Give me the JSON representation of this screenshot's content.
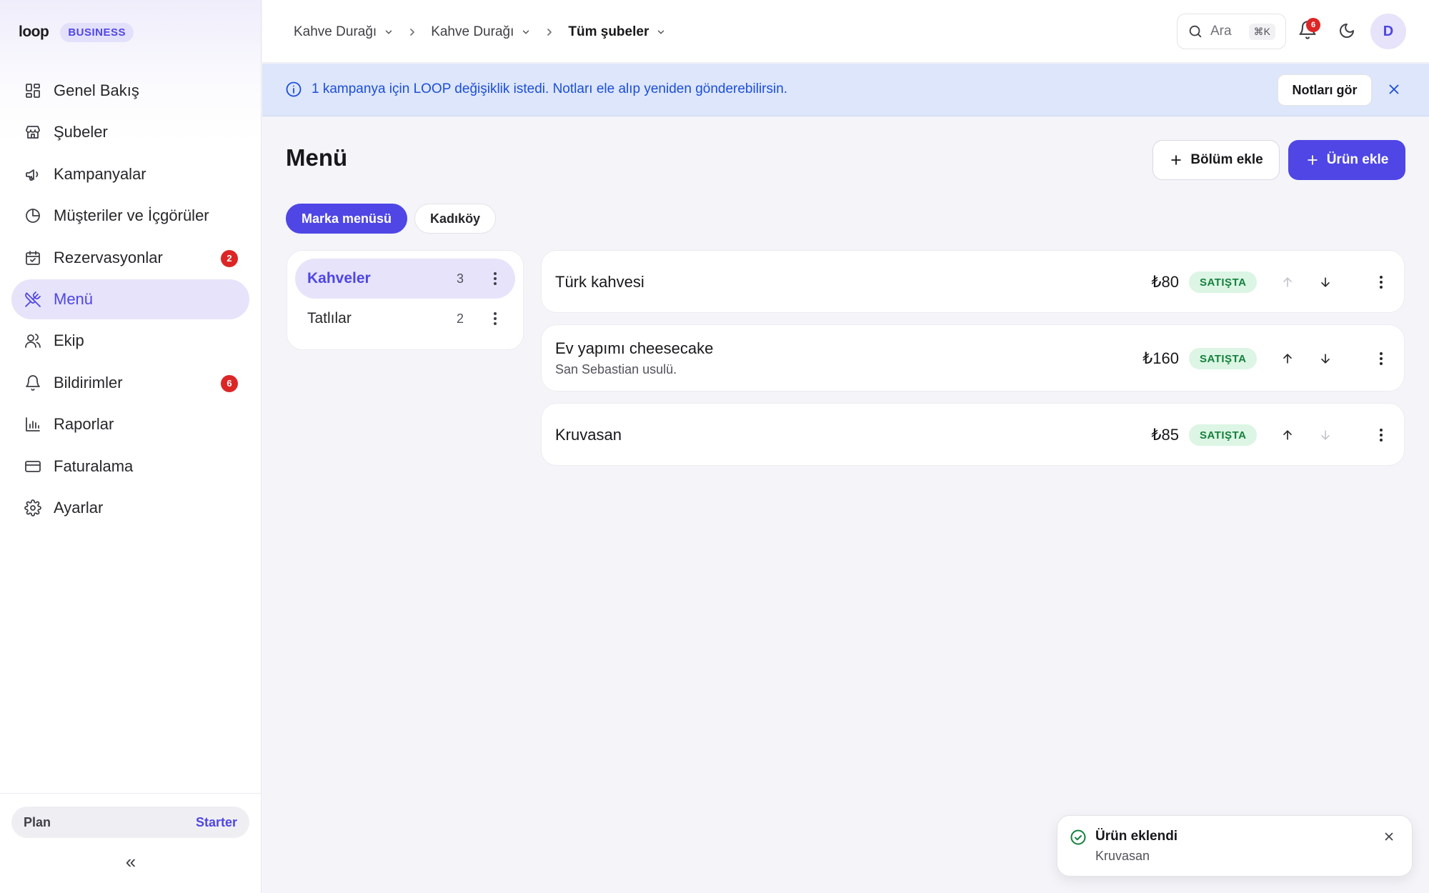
{
  "brand": {
    "logo_text": "loop",
    "badge": "BUSINESS"
  },
  "sidebar": {
    "items": [
      {
        "label": "Genel Bakış",
        "icon": "dashboard-icon",
        "active": false
      },
      {
        "label": "Şubeler",
        "icon": "store-icon",
        "active": false
      },
      {
        "label": "Kampanyalar",
        "icon": "megaphone-icon",
        "active": false
      },
      {
        "label": "Müşteriler ve İçgörüler",
        "icon": "pie-chart-icon",
        "active": false
      },
      {
        "label": "Rezervasyonlar",
        "icon": "calendar-check-icon",
        "active": false,
        "badge": "2"
      },
      {
        "label": "Menü",
        "icon": "utensils-crossed-icon",
        "active": true
      },
      {
        "label": "Ekip",
        "icon": "users-icon",
        "active": false
      },
      {
        "label": "Bildirimler",
        "icon": "bell-icon",
        "active": false,
        "badge": "6"
      },
      {
        "label": "Raporlar",
        "icon": "bar-chart-icon",
        "active": false
      },
      {
        "label": "Faturalama",
        "icon": "credit-card-icon",
        "active": false
      },
      {
        "label": "Ayarlar",
        "icon": "gear-icon",
        "active": false
      }
    ],
    "plan": {
      "label": "Plan",
      "value": "Starter"
    },
    "collapse_glyph": "«"
  },
  "topbar": {
    "breadcrumbs": [
      {
        "label": "Kahve Durağı"
      },
      {
        "label": "Kahve Durağı"
      },
      {
        "label": "Tüm şubeler"
      }
    ],
    "search": {
      "placeholder": "Ara",
      "shortcut": "⌘K"
    },
    "notifications_count": "6",
    "avatar_initial": "D"
  },
  "banner": {
    "text": "1 kampanya için LOOP değişiklik istedi. Notları ele alıp yeniden gönderebilirsin.",
    "button": "Notları gör"
  },
  "main": {
    "title": "Menü",
    "add_section_label": "Bölüm ekle",
    "add_product_label": "Ürün ekle",
    "tabs": [
      {
        "label": "Marka menüsü",
        "active": true
      },
      {
        "label": "Kadıköy",
        "active": false
      }
    ],
    "sections": [
      {
        "name": "Kahveler",
        "count": "3",
        "active": true
      },
      {
        "name": "Tatlılar",
        "count": "2",
        "active": false
      }
    ],
    "products": [
      {
        "name": "Türk kahvesi",
        "description": "",
        "price": "₺80",
        "status": "SATIŞTA",
        "up_enabled": false,
        "down_enabled": true
      },
      {
        "name": "Ev yapımı cheesecake",
        "description": "San Sebastian usulü.",
        "price": "₺160",
        "status": "SATIŞTA",
        "up_enabled": true,
        "down_enabled": true
      },
      {
        "name": "Kruvasan",
        "description": "",
        "price": "₺85",
        "status": "SATIŞTA",
        "up_enabled": true,
        "down_enabled": false
      }
    ]
  },
  "toast": {
    "title": "Ürün eklendi",
    "subtitle": "Kruvasan"
  },
  "colors": {
    "accent": "#4f46e5",
    "badge_red": "#dc2626",
    "status_green": "#15803d",
    "banner_blue": "#1d4ed8"
  }
}
